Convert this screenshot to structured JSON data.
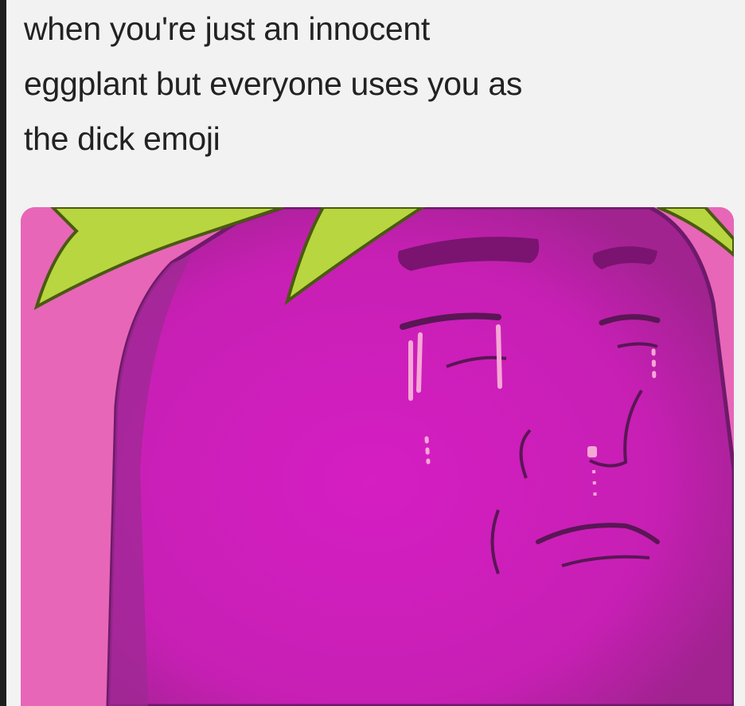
{
  "meme": {
    "caption_lines": [
      "when you're just an innocent",
      "eggplant but everyone uses you as",
      "the dick emoji"
    ],
    "picture_subject": "crying-eggplant",
    "colors": {
      "background": "#f2f2f2",
      "caption_text": "#222222",
      "eggplant": "#c71fb4",
      "pink_background": "#e766b8",
      "leaf": "#b8d640",
      "outline": "#6e1a6a"
    }
  }
}
